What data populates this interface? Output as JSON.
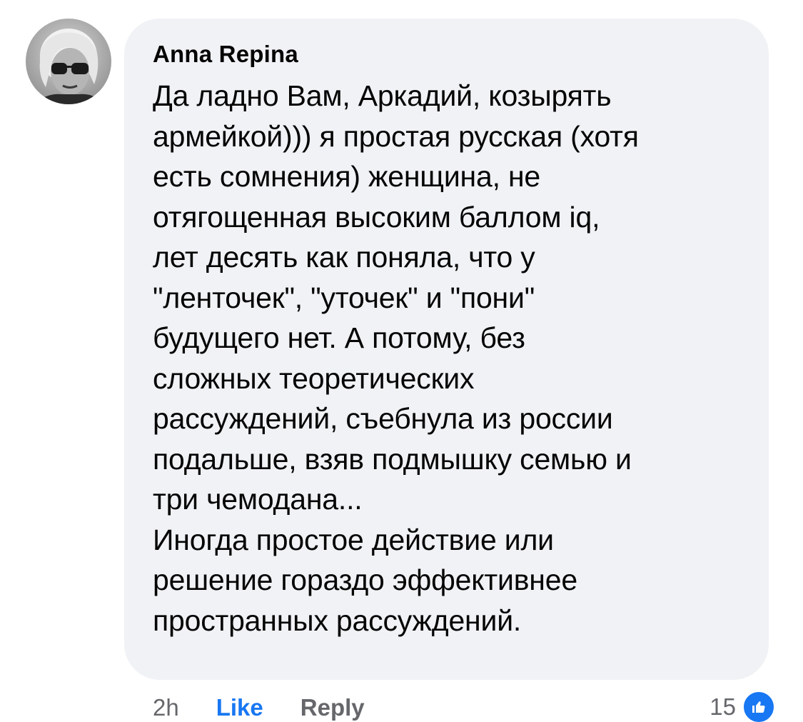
{
  "comment": {
    "author": "Anna Repina",
    "text": "Да ладно Вам, Аркадий, козырять\nармейкой))) я простая русская (хотя\nесть сомнения) женщина, не\nотягощенная высоким баллом iq,\nлет десять как поняла, что у\n\"ленточек\", \"уточек\" и \"пони\"\nбудущего нет. А потому, без\nсложных теоретических\nрассуждений, съебнула из россии\nподальше, взяв подмышку семью и\nтри чемодана...\nИногда простое действие или\nрешение гораздо эффективнее\nпространных рассуждений.",
    "avatar_icon": "user-avatar-photo"
  },
  "actions": {
    "time": "2h",
    "like_label": "Like",
    "reply_label": "Reply"
  },
  "reactions": {
    "count": "15",
    "icon": "thumbs-up-icon",
    "color": "#1877f2"
  },
  "colors": {
    "bubble_bg": "#f0f2f5",
    "text": "#050505",
    "secondary": "#65676b",
    "accent": "#1877f2"
  }
}
